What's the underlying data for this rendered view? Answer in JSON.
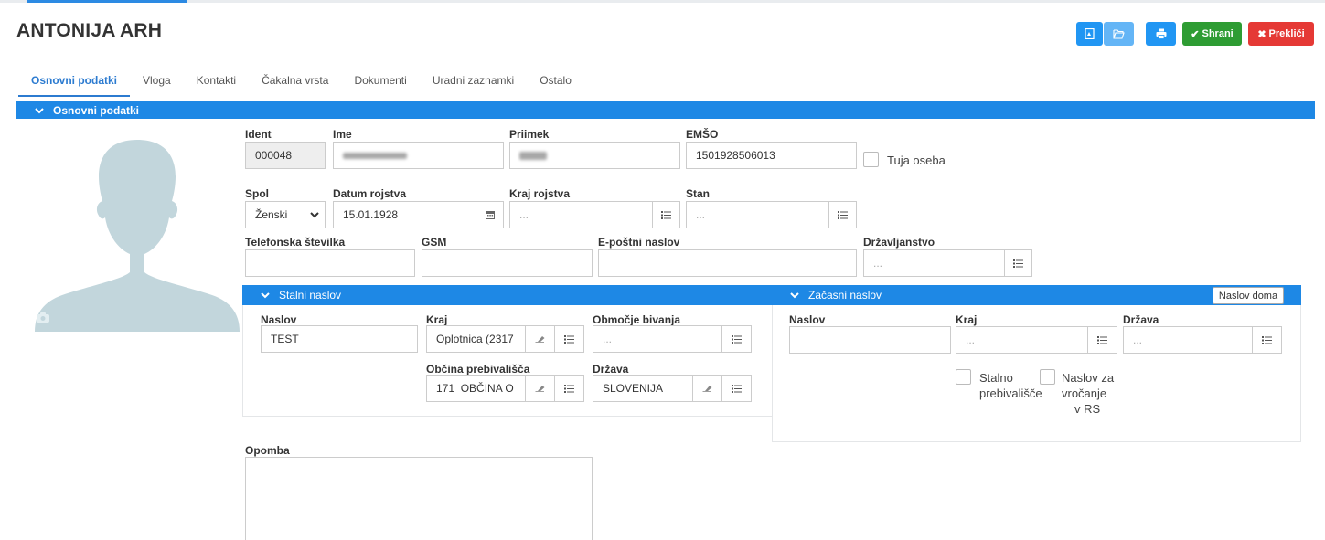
{
  "header": {
    "title": "ANTONIJA ARH",
    "buttons": {
      "pdf_icon": "pdf-icon",
      "folder_icon": "folder-open-icon",
      "print_icon": "print-icon",
      "save_label": "Shrani",
      "cancel_label": "Prekliči"
    }
  },
  "colors": {
    "primary": "#1e88e5",
    "save": "#2e9c33",
    "cancel": "#e53935",
    "tab_active": "#2c7bd0"
  },
  "tabs": [
    {
      "label": "Osnovni podatki",
      "active": true
    },
    {
      "label": "Vloga"
    },
    {
      "label": "Kontakti"
    },
    {
      "label": "Čakalna vrsta"
    },
    {
      "label": "Dokumenti"
    },
    {
      "label": "Uradni zaznamki"
    },
    {
      "label": "Ostalo"
    }
  ],
  "section": {
    "title": "Osnovni podatki"
  },
  "form": {
    "ident": {
      "label": "Ident",
      "value": "000048"
    },
    "ime": {
      "label": "Ime"
    },
    "priimek": {
      "label": "Priimek"
    },
    "emso": {
      "label": "EMŠO",
      "value": "1501928506013"
    },
    "tuja_oseba": {
      "label": "Tuja oseba",
      "checked": false
    },
    "spol": {
      "label": "Spol",
      "value": "Ženski"
    },
    "datum_rojstva": {
      "label": "Datum rojstva",
      "value": "15.01.1928"
    },
    "kraj_rojstva": {
      "label": "Kraj rojstva",
      "placeholder": "..."
    },
    "stan": {
      "label": "Stan",
      "placeholder": "..."
    },
    "telefon": {
      "label": "Telefonska številka",
      "value": ""
    },
    "gsm": {
      "label": "GSM",
      "value": ""
    },
    "email": {
      "label": "E-poštni naslov",
      "value": ""
    },
    "drzavljanstvo": {
      "label": "Državljanstvo",
      "placeholder": "..."
    },
    "opomba": {
      "label": "Opomba",
      "value": ""
    }
  },
  "stalni_naslov": {
    "title": "Stalni naslov",
    "naslov": {
      "label": "Naslov",
      "value": "TEST"
    },
    "kraj": {
      "label": "Kraj",
      "value": "Oplotnica (2317"
    },
    "obmocje": {
      "label": "Območje bivanja",
      "placeholder": "..."
    },
    "obcina": {
      "label": "Občina prebivališča",
      "value": "171  OBČINA O"
    },
    "drzava": {
      "label": "Država",
      "value": "SLOVENIJA"
    }
  },
  "zacasni_naslov": {
    "title": "Začasni naslov",
    "naslov_doma_label": "Naslov doma",
    "naslov": {
      "label": "Naslov",
      "value": ""
    },
    "kraj": {
      "label": "Kraj",
      "placeholder": "..."
    },
    "drzava": {
      "label": "Država",
      "placeholder": "..."
    },
    "stalno_prebivalisce": {
      "line1": "Stalno",
      "line2": "prebivališče",
      "checked": false
    },
    "naslov_za_vrocanje": {
      "line1": "Naslov za",
      "line2": "vročanje",
      "line3": "v RS",
      "checked": false
    }
  }
}
